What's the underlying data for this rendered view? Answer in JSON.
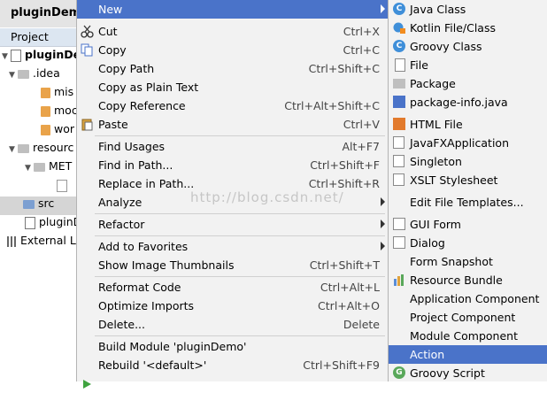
{
  "project_panel": {
    "title": "pluginDemo",
    "tab": "Project",
    "tree": [
      {
        "label": "pluginDem",
        "bold": true
      },
      {
        "label": ".idea"
      },
      {
        "label": "mis"
      },
      {
        "label": "moc"
      },
      {
        "label": "wor"
      },
      {
        "label": "resourc"
      },
      {
        "label": "MET"
      },
      {
        "label": ""
      },
      {
        "label": "src"
      },
      {
        "label": "pluginD"
      },
      {
        "label": "External Lil"
      }
    ]
  },
  "context_menu": {
    "items": [
      {
        "label": "New",
        "shortcut": ""
      },
      {
        "label": "Cut",
        "shortcut": "Ctrl+X"
      },
      {
        "label": "Copy",
        "shortcut": "Ctrl+C"
      },
      {
        "label": "Copy Path",
        "shortcut": "Ctrl+Shift+C"
      },
      {
        "label": "Copy as Plain Text",
        "shortcut": ""
      },
      {
        "label": "Copy Reference",
        "shortcut": "Ctrl+Alt+Shift+C"
      },
      {
        "label": "Paste",
        "shortcut": "Ctrl+V"
      },
      {
        "label": "Find Usages",
        "shortcut": "Alt+F7"
      },
      {
        "label": "Find in Path...",
        "shortcut": "Ctrl+Shift+F"
      },
      {
        "label": "Replace in Path...",
        "shortcut": "Ctrl+Shift+R"
      },
      {
        "label": "Analyze",
        "shortcut": ""
      },
      {
        "label": "Refactor",
        "shortcut": ""
      },
      {
        "label": "Add to Favorites",
        "shortcut": ""
      },
      {
        "label": "Show Image Thumbnails",
        "shortcut": "Ctrl+Shift+T"
      },
      {
        "label": "Reformat Code",
        "shortcut": "Ctrl+Alt+L"
      },
      {
        "label": "Optimize Imports",
        "shortcut": "Ctrl+Alt+O"
      },
      {
        "label": "Delete...",
        "shortcut": "Delete"
      },
      {
        "label": "Build Module 'pluginDemo'",
        "shortcut": ""
      },
      {
        "label": "Rebuild '<default>'",
        "shortcut": "Ctrl+Shift+F9"
      }
    ]
  },
  "new_submenu": {
    "items": [
      {
        "label": "Java Class",
        "icon": "java-class-icon"
      },
      {
        "label": "Kotlin File/Class",
        "icon": "kotlin-icon"
      },
      {
        "label": "Groovy Class",
        "icon": "groovy-class-icon"
      },
      {
        "label": "File",
        "icon": "file-icon"
      },
      {
        "label": "Package",
        "icon": "package-icon"
      },
      {
        "label": "package-info.java",
        "icon": "package-info-icon"
      },
      {
        "label": "HTML File",
        "icon": "html-file-icon"
      },
      {
        "label": "JavaFXApplication",
        "icon": "javafx-icon"
      },
      {
        "label": "Singleton",
        "icon": "singleton-icon"
      },
      {
        "label": "XSLT Stylesheet",
        "icon": "xslt-icon"
      },
      {
        "label": "Edit File Templates...",
        "icon": ""
      },
      {
        "label": "GUI Form",
        "icon": "gui-form-icon"
      },
      {
        "label": "Dialog",
        "icon": "dialog-icon"
      },
      {
        "label": "Form Snapshot",
        "icon": ""
      },
      {
        "label": "Resource Bundle",
        "icon": "resource-bundle-icon"
      },
      {
        "label": "Application Component",
        "icon": ""
      },
      {
        "label": "Project Component",
        "icon": ""
      },
      {
        "label": "Module Component",
        "icon": ""
      },
      {
        "label": "Action",
        "icon": ""
      },
      {
        "label": "Groovy Script",
        "icon": "groovy-script-icon"
      }
    ]
  },
  "watermark": "http://blog.csdn.net/",
  "colors": {
    "highlight": "#4a73c9",
    "menu_bg": "#f2f2f2"
  }
}
